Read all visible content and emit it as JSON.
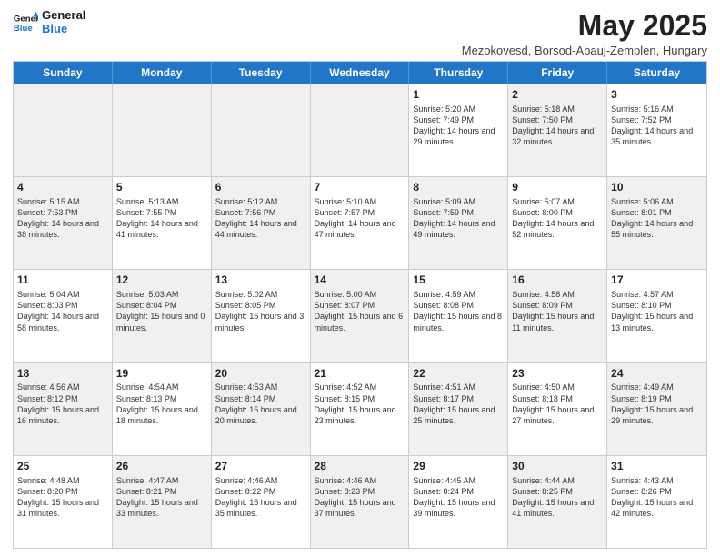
{
  "logo": {
    "line1": "General",
    "line2": "Blue"
  },
  "title": "May 2025",
  "subtitle": "Mezokovesd, Borsod-Abauj-Zemplen, Hungary",
  "headers": [
    "Sunday",
    "Monday",
    "Tuesday",
    "Wednesday",
    "Thursday",
    "Friday",
    "Saturday"
  ],
  "rows": [
    [
      {
        "day": "",
        "text": "",
        "shaded": true
      },
      {
        "day": "",
        "text": "",
        "shaded": true
      },
      {
        "day": "",
        "text": "",
        "shaded": true
      },
      {
        "day": "",
        "text": "",
        "shaded": true
      },
      {
        "day": "1",
        "text": "Sunrise: 5:20 AM\nSunset: 7:49 PM\nDaylight: 14 hours\nand 29 minutes.",
        "shaded": false
      },
      {
        "day": "2",
        "text": "Sunrise: 5:18 AM\nSunset: 7:50 PM\nDaylight: 14 hours\nand 32 minutes.",
        "shaded": true
      },
      {
        "day": "3",
        "text": "Sunrise: 5:16 AM\nSunset: 7:52 PM\nDaylight: 14 hours\nand 35 minutes.",
        "shaded": false
      }
    ],
    [
      {
        "day": "4",
        "text": "Sunrise: 5:15 AM\nSunset: 7:53 PM\nDaylight: 14 hours\nand 38 minutes.",
        "shaded": true
      },
      {
        "day": "5",
        "text": "Sunrise: 5:13 AM\nSunset: 7:55 PM\nDaylight: 14 hours\nand 41 minutes.",
        "shaded": false
      },
      {
        "day": "6",
        "text": "Sunrise: 5:12 AM\nSunset: 7:56 PM\nDaylight: 14 hours\nand 44 minutes.",
        "shaded": true
      },
      {
        "day": "7",
        "text": "Sunrise: 5:10 AM\nSunset: 7:57 PM\nDaylight: 14 hours\nand 47 minutes.",
        "shaded": false
      },
      {
        "day": "8",
        "text": "Sunrise: 5:09 AM\nSunset: 7:59 PM\nDaylight: 14 hours\nand 49 minutes.",
        "shaded": true
      },
      {
        "day": "9",
        "text": "Sunrise: 5:07 AM\nSunset: 8:00 PM\nDaylight: 14 hours\nand 52 minutes.",
        "shaded": false
      },
      {
        "day": "10",
        "text": "Sunrise: 5:06 AM\nSunset: 8:01 PM\nDaylight: 14 hours\nand 55 minutes.",
        "shaded": true
      }
    ],
    [
      {
        "day": "11",
        "text": "Sunrise: 5:04 AM\nSunset: 8:03 PM\nDaylight: 14 hours\nand 58 minutes.",
        "shaded": false
      },
      {
        "day": "12",
        "text": "Sunrise: 5:03 AM\nSunset: 8:04 PM\nDaylight: 15 hours\nand 0 minutes.",
        "shaded": true
      },
      {
        "day": "13",
        "text": "Sunrise: 5:02 AM\nSunset: 8:05 PM\nDaylight: 15 hours\nand 3 minutes.",
        "shaded": false
      },
      {
        "day": "14",
        "text": "Sunrise: 5:00 AM\nSunset: 8:07 PM\nDaylight: 15 hours\nand 6 minutes.",
        "shaded": true
      },
      {
        "day": "15",
        "text": "Sunrise: 4:59 AM\nSunset: 8:08 PM\nDaylight: 15 hours\nand 8 minutes.",
        "shaded": false
      },
      {
        "day": "16",
        "text": "Sunrise: 4:58 AM\nSunset: 8:09 PM\nDaylight: 15 hours\nand 11 minutes.",
        "shaded": true
      },
      {
        "day": "17",
        "text": "Sunrise: 4:57 AM\nSunset: 8:10 PM\nDaylight: 15 hours\nand 13 minutes.",
        "shaded": false
      }
    ],
    [
      {
        "day": "18",
        "text": "Sunrise: 4:56 AM\nSunset: 8:12 PM\nDaylight: 15 hours\nand 16 minutes.",
        "shaded": true
      },
      {
        "day": "19",
        "text": "Sunrise: 4:54 AM\nSunset: 8:13 PM\nDaylight: 15 hours\nand 18 minutes.",
        "shaded": false
      },
      {
        "day": "20",
        "text": "Sunrise: 4:53 AM\nSunset: 8:14 PM\nDaylight: 15 hours\nand 20 minutes.",
        "shaded": true
      },
      {
        "day": "21",
        "text": "Sunrise: 4:52 AM\nSunset: 8:15 PM\nDaylight: 15 hours\nand 23 minutes.",
        "shaded": false
      },
      {
        "day": "22",
        "text": "Sunrise: 4:51 AM\nSunset: 8:17 PM\nDaylight: 15 hours\nand 25 minutes.",
        "shaded": true
      },
      {
        "day": "23",
        "text": "Sunrise: 4:50 AM\nSunset: 8:18 PM\nDaylight: 15 hours\nand 27 minutes.",
        "shaded": false
      },
      {
        "day": "24",
        "text": "Sunrise: 4:49 AM\nSunset: 8:19 PM\nDaylight: 15 hours\nand 29 minutes.",
        "shaded": true
      }
    ],
    [
      {
        "day": "25",
        "text": "Sunrise: 4:48 AM\nSunset: 8:20 PM\nDaylight: 15 hours\nand 31 minutes.",
        "shaded": false
      },
      {
        "day": "26",
        "text": "Sunrise: 4:47 AM\nSunset: 8:21 PM\nDaylight: 15 hours\nand 33 minutes.",
        "shaded": true
      },
      {
        "day": "27",
        "text": "Sunrise: 4:46 AM\nSunset: 8:22 PM\nDaylight: 15 hours\nand 35 minutes.",
        "shaded": false
      },
      {
        "day": "28",
        "text": "Sunrise: 4:46 AM\nSunset: 8:23 PM\nDaylight: 15 hours\nand 37 minutes.",
        "shaded": true
      },
      {
        "day": "29",
        "text": "Sunrise: 4:45 AM\nSunset: 8:24 PM\nDaylight: 15 hours\nand 39 minutes.",
        "shaded": false
      },
      {
        "day": "30",
        "text": "Sunrise: 4:44 AM\nSunset: 8:25 PM\nDaylight: 15 hours\nand 41 minutes.",
        "shaded": true
      },
      {
        "day": "31",
        "text": "Sunrise: 4:43 AM\nSunset: 8:26 PM\nDaylight: 15 hours\nand 42 minutes.",
        "shaded": false
      }
    ]
  ]
}
